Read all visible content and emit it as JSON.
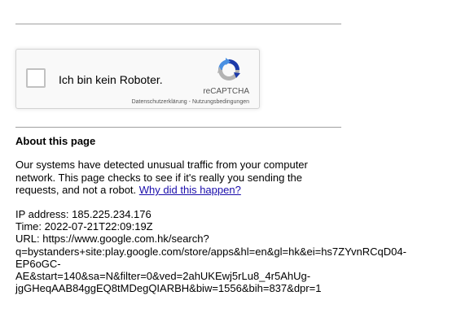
{
  "recaptcha": {
    "checkbox_label": "Ich bin kein Roboter.",
    "brand": "reCAPTCHA",
    "privacy_link": "Datenschutzerklärung",
    "separator": " - ",
    "terms_link": "Nutzungsbedingungen",
    "logo_icon": "recaptcha-logo-icon",
    "colors": {
      "blue": "#4a90e2",
      "dark_blue": "#1c3aa9",
      "grey": "#b3b3b3"
    }
  },
  "about": {
    "heading": "About this page",
    "paragraph_text": "Our systems have detected unusual traffic from your computer network. This page checks to see if it's really you sending the requests, and not a robot.",
    "why_link": "Why did this happen?",
    "link_color": "#1a0dab"
  },
  "info": {
    "ip_line": "IP address: 185.225.234.176",
    "time_line": "Time: 2022-07-21T22:09:19Z",
    "url_line_1": "URL: https://www.google.com.hk/search?",
    "url_line_2": "q=bystanders+site:play.google.com/store/apps&hl=en&gl=hk&ei=hs7ZYvnRCqD04-",
    "url_line_3": "EP6oGC-",
    "url_line_4": "AE&start=140&sa=N&filter=0&ved=2ahUKEwj5rLu8_4r5AhUg-",
    "url_line_5": "jgGHeqAAB84ggEQ8tMDegQIARBH&biw=1556&bih=837&dpr=1"
  }
}
